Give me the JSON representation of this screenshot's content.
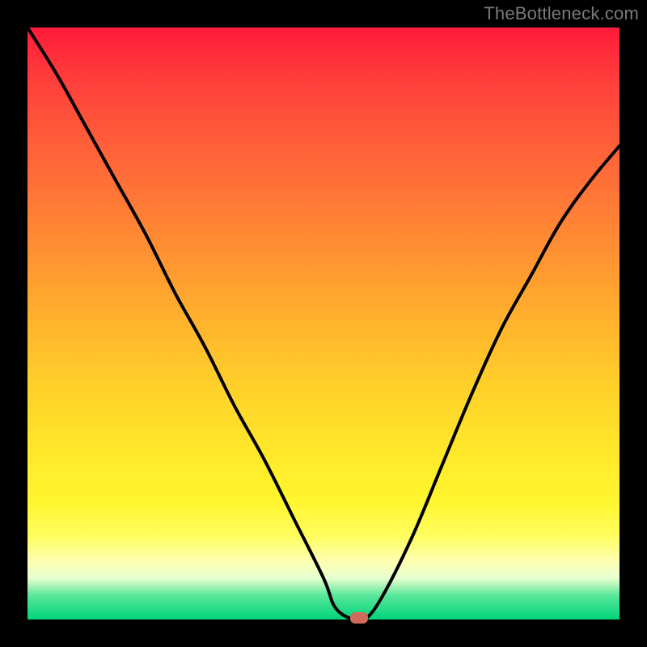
{
  "watermark": {
    "text": "TheBottleneck.com"
  },
  "colors": {
    "frame": "#000000",
    "curve": "#000000",
    "marker": "#cf6a5c",
    "gradient_stops": [
      "#ff1a3a",
      "#ffa52e",
      "#fff62e",
      "#00d47a"
    ]
  },
  "chart_data": {
    "type": "line",
    "title": "",
    "xlabel": "",
    "ylabel": "",
    "xlim": [
      0,
      100
    ],
    "ylim": [
      0,
      100
    ],
    "grid": false,
    "legend": false,
    "series": [
      {
        "name": "bottleneck-curve",
        "x": [
          0,
          5,
          10,
          15,
          20,
          25,
          30,
          35,
          40,
          45,
          50,
          52,
          55,
          57,
          60,
          65,
          70,
          75,
          80,
          85,
          90,
          95,
          100
        ],
        "values": [
          100,
          92,
          83,
          74,
          65,
          55,
          46,
          36,
          27,
          17,
          7,
          2,
          0,
          0,
          4,
          14,
          26,
          38,
          49,
          58,
          67,
          74,
          80
        ]
      }
    ],
    "annotations": [
      {
        "name": "min-marker",
        "x": 56,
        "y": 0
      }
    ]
  }
}
